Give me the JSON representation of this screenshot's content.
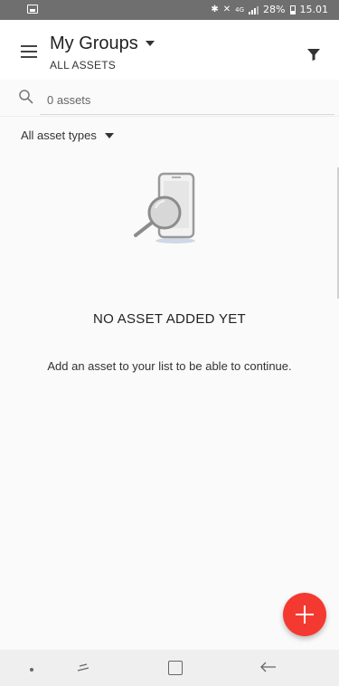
{
  "status_bar": {
    "battery_percent": "28%",
    "time": "15.01",
    "network_label": "4G",
    "icons": [
      "image-icon",
      "bluetooth-icon",
      "mute-icon",
      "network-icon",
      "signal-icon",
      "battery-icon"
    ]
  },
  "appbar": {
    "title": "My Groups",
    "subtitle": "ALL ASSETS",
    "icons": [
      "menu-icon",
      "dropdown-caret-icon",
      "filter-icon"
    ]
  },
  "search": {
    "placeholder": "0 assets",
    "value": ""
  },
  "filter": {
    "label": "All asset types"
  },
  "empty_state": {
    "title": "NO ASSET ADDED YET",
    "message": "Add an asset to your list to be able to continue.",
    "illustration_icon": "phone-magnifier-icon"
  },
  "fab": {
    "icon": "plus-icon",
    "color": "#f43a30"
  },
  "navbar": {
    "icons": [
      "dot-icon",
      "recent-apps-icon",
      "home-icon",
      "back-icon"
    ]
  },
  "colors": {
    "accent": "#f43a30",
    "status_bar": "#6f6f6f",
    "background": "#fafafa"
  }
}
